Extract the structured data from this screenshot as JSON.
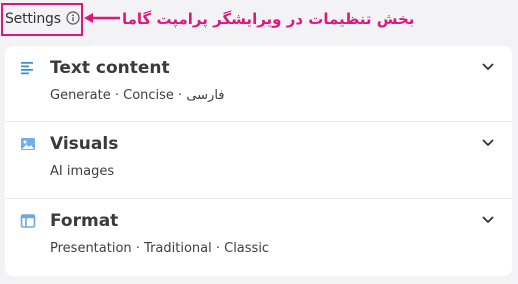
{
  "header": {
    "settings_label": "Settings",
    "info_icon": "info-circle-icon",
    "annotation": "بخش تنظیمات در ویرایشگر پرامپت گاما",
    "annotation_color": "#e0177b"
  },
  "rows": [
    {
      "icon": "text-lines-icon",
      "title": "Text content",
      "subtitle": "Generate · Concise · فارسی"
    },
    {
      "icon": "image-icon",
      "title": "Visuals",
      "subtitle": "AI images"
    },
    {
      "icon": "layout-window-icon",
      "title": "Format",
      "subtitle": "Presentation · Traditional · Classic"
    }
  ],
  "colors": {
    "accent_blue": "#3b8ddb",
    "background": "#f3f3f6",
    "card": "#ffffff"
  }
}
